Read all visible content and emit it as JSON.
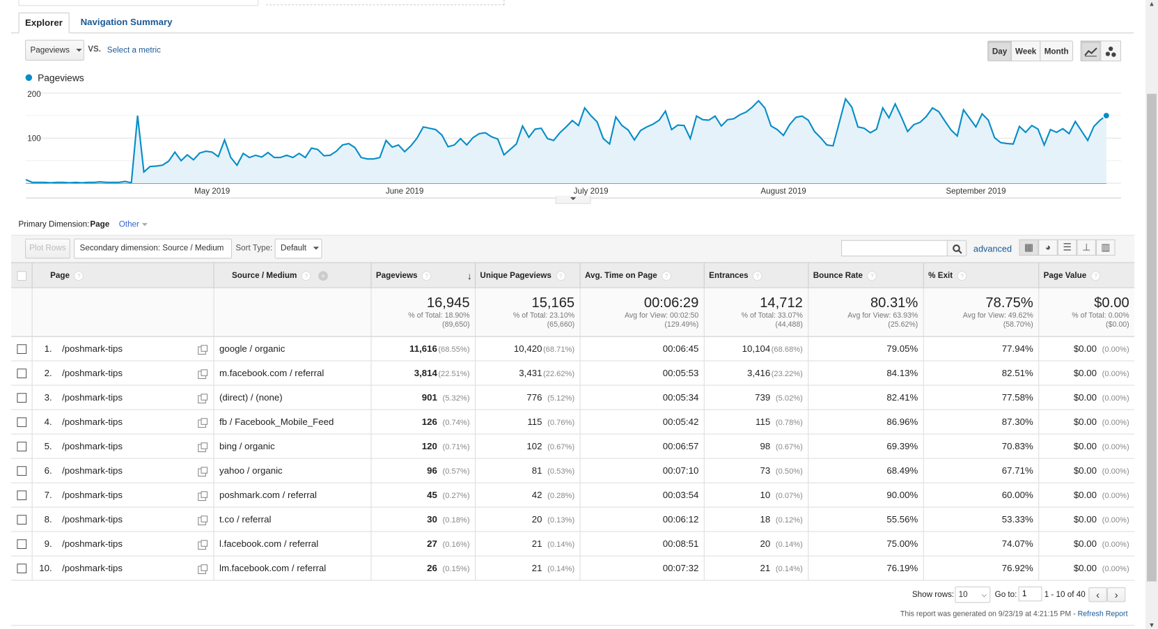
{
  "tabs": {
    "explorer": "Explorer",
    "navigation_summary": "Navigation Summary"
  },
  "metric_selector": {
    "selected": "Pageviews",
    "vs_label": "VS.",
    "select_metric_link": "Select a metric"
  },
  "granularity": {
    "options": [
      "Day",
      "Week",
      "Month"
    ],
    "selected": "Day"
  },
  "chart_type_buttons": [
    "line-chart-icon",
    "motion-chart-icon"
  ],
  "chart_data": {
    "type": "area",
    "series": [
      {
        "name": "Pageviews",
        "color": "#058dc7",
        "frequency": "day",
        "date_range": [
          "2019-04-01",
          "2019-09-22"
        ],
        "values": [
          8,
          2,
          2,
          2,
          1,
          2,
          2,
          1,
          2,
          1,
          2,
          2,
          3,
          2,
          2,
          2,
          4,
          1,
          150,
          25,
          37,
          38,
          40,
          49,
          69,
          50,
          63,
          52,
          67,
          71,
          69,
          59,
          96,
          57,
          40,
          66,
          57,
          62,
          58,
          68,
          57,
          57,
          62,
          57,
          66,
          57,
          78,
          75,
          61,
          62,
          71,
          85,
          88,
          79,
          57,
          54,
          54,
          57,
          95,
          80,
          85,
          70,
          83,
          100,
          125,
          122,
          119,
          107,
          81,
          85,
          99,
          85,
          101,
          110,
          112,
          103,
          98,
          63,
          75,
          87,
          127,
          102,
          120,
          122,
          99,
          95,
          112,
          125,
          139,
          128,
          167,
          150,
          136,
          99,
          87,
          147,
          128,
          118,
          96,
          117,
          125,
          131,
          140,
          160,
          119,
          129,
          128,
          99,
          149,
          141,
          140,
          149,
          127,
          141,
          143,
          152,
          158,
          169,
          183,
          167,
          127,
          119,
          106,
          130,
          146,
          149,
          140,
          115,
          101,
          85,
          83,
          135,
          187,
          169,
          125,
          122,
          112,
          120,
          167,
          145,
          176,
          147,
          115,
          130,
          135,
          148,
          167,
          159,
          138,
          118,
          105,
          163,
          144,
          125,
          154,
          140,
          101,
          90,
          88,
          87,
          126,
          113,
          128,
          120,
          85,
          119,
          113,
          121,
          110,
          137,
          116,
          95,
          126,
          140,
          150
        ]
      }
    ],
    "legend": "Pageviews",
    "legend_placement": "top-left",
    "y_ticks": [
      "100",
      "200"
    ],
    "ylim": [
      0,
      200
    ],
    "x_ticks": [
      {
        "date": "2019-05-01",
        "label": "May 2019"
      },
      {
        "date": "2019-06-01",
        "label": "June 2019"
      },
      {
        "date": "2019-07-01",
        "label": "July 2019"
      },
      {
        "date": "2019-08-01",
        "label": "August 2019"
      },
      {
        "date": "2019-09-01",
        "label": "September 2019"
      }
    ],
    "grid": true
  },
  "dimension": {
    "label": "Primary Dimension:",
    "selected": "Page",
    "other": "Other"
  },
  "toolbar": {
    "plot_rows": "Plot Rows",
    "secondary_dimension": "Secondary dimension: Source / Medium",
    "sort_type_label": "Sort Type:",
    "sort_type": "Default",
    "search_placeholder": "",
    "advanced": "advanced"
  },
  "table": {
    "headers": {
      "page": "Page",
      "source_medium": "Source / Medium",
      "pageviews": "Pageviews",
      "unique_pageviews": "Unique Pageviews",
      "avg_time": "Avg. Time on Page",
      "entrances": "Entrances",
      "bounce_rate": "Bounce Rate",
      "exit": "% Exit",
      "page_value": "Page Value"
    },
    "totals": {
      "pageviews": {
        "value": "16,945",
        "line1": "% of Total: 18.90%",
        "line2": "(89,650)"
      },
      "unique_pageviews": {
        "value": "15,165",
        "line1": "% of Total: 23.10%",
        "line2": "(65,660)"
      },
      "avg_time": {
        "value": "00:06:29",
        "line1": "Avg for View: 00:02:50",
        "line2": "(129.49%)"
      },
      "entrances": {
        "value": "14,712",
        "line1": "% of Total: 33.07%",
        "line2": "(44,488)"
      },
      "bounce_rate": {
        "value": "80.31%",
        "line1": "Avg for View: 63.93%",
        "line2": "(25.62%)"
      },
      "exit": {
        "value": "78.75%",
        "line1": "Avg for View: 49.62%",
        "line2": "(58.70%)"
      },
      "page_value": {
        "value": "$0.00",
        "line1": "% of Total: 0.00%",
        "line2": "($0.00)"
      }
    },
    "rows": [
      {
        "num": "1.",
        "page": "/poshmark-tips",
        "source": "google / organic",
        "pv": "11,616",
        "pv_pct": "(68.55%)",
        "upv": "10,420",
        "upv_pct": "(68.71%)",
        "time": "00:06:45",
        "ent": "10,104",
        "ent_pct": "(68.68%)",
        "bounce": "79.05%",
        "exit": "77.94%",
        "value": "$0.00",
        "value_pct": "(0.00%)"
      },
      {
        "num": "2.",
        "page": "/poshmark-tips",
        "source": "m.facebook.com / referral",
        "pv": "3,814",
        "pv_pct": "(22.51%)",
        "upv": "3,431",
        "upv_pct": "(22.62%)",
        "time": "00:05:53",
        "ent": "3,416",
        "ent_pct": "(23.22%)",
        "bounce": "84.13%",
        "exit": "82.51%",
        "value": "$0.00",
        "value_pct": "(0.00%)"
      },
      {
        "num": "3.",
        "page": "/poshmark-tips",
        "source": "(direct) / (none)",
        "pv": "901",
        "pv_pct": "(5.32%)",
        "upv": "776",
        "upv_pct": "(5.12%)",
        "time": "00:05:34",
        "ent": "739",
        "ent_pct": "(5.02%)",
        "bounce": "82.41%",
        "exit": "77.58%",
        "value": "$0.00",
        "value_pct": "(0.00%)"
      },
      {
        "num": "4.",
        "page": "/poshmark-tips",
        "source": "fb / Facebook_Mobile_Feed",
        "pv": "126",
        "pv_pct": "(0.74%)",
        "upv": "115",
        "upv_pct": "(0.76%)",
        "time": "00:05:42",
        "ent": "115",
        "ent_pct": "(0.78%)",
        "bounce": "86.96%",
        "exit": "87.30%",
        "value": "$0.00",
        "value_pct": "(0.00%)"
      },
      {
        "num": "5.",
        "page": "/poshmark-tips",
        "source": "bing / organic",
        "pv": "120",
        "pv_pct": "(0.71%)",
        "upv": "102",
        "upv_pct": "(0.67%)",
        "time": "00:06:57",
        "ent": "98",
        "ent_pct": "(0.67%)",
        "bounce": "69.39%",
        "exit": "70.83%",
        "value": "$0.00",
        "value_pct": "(0.00%)"
      },
      {
        "num": "6.",
        "page": "/poshmark-tips",
        "source": "yahoo / organic",
        "pv": "96",
        "pv_pct": "(0.57%)",
        "upv": "81",
        "upv_pct": "(0.53%)",
        "time": "00:07:10",
        "ent": "73",
        "ent_pct": "(0.50%)",
        "bounce": "68.49%",
        "exit": "67.71%",
        "value": "$0.00",
        "value_pct": "(0.00%)"
      },
      {
        "num": "7.",
        "page": "/poshmark-tips",
        "source": "poshmark.com / referral",
        "pv": "45",
        "pv_pct": "(0.27%)",
        "upv": "42",
        "upv_pct": "(0.28%)",
        "time": "00:03:54",
        "ent": "10",
        "ent_pct": "(0.07%)",
        "bounce": "90.00%",
        "exit": "60.00%",
        "value": "$0.00",
        "value_pct": "(0.00%)"
      },
      {
        "num": "8.",
        "page": "/poshmark-tips",
        "source": "t.co / referral",
        "pv": "30",
        "pv_pct": "(0.18%)",
        "upv": "20",
        "upv_pct": "(0.13%)",
        "time": "00:06:12",
        "ent": "18",
        "ent_pct": "(0.12%)",
        "bounce": "55.56%",
        "exit": "53.33%",
        "value": "$0.00",
        "value_pct": "(0.00%)"
      },
      {
        "num": "9.",
        "page": "/poshmark-tips",
        "source": "l.facebook.com / referral",
        "pv": "27",
        "pv_pct": "(0.16%)",
        "upv": "21",
        "upv_pct": "(0.14%)",
        "time": "00:08:51",
        "ent": "20",
        "ent_pct": "(0.14%)",
        "bounce": "75.00%",
        "exit": "74.07%",
        "value": "$0.00",
        "value_pct": "(0.00%)"
      },
      {
        "num": "10.",
        "page": "/poshmark-tips",
        "source": "lm.facebook.com / referral",
        "pv": "26",
        "pv_pct": "(0.15%)",
        "upv": "21",
        "upv_pct": "(0.14%)",
        "time": "00:07:32",
        "ent": "21",
        "ent_pct": "(0.14%)",
        "bounce": "76.19%",
        "exit": "76.92%",
        "value": "$0.00",
        "value_pct": "(0.00%)"
      }
    ]
  },
  "pagination": {
    "show_rows_label": "Show rows:",
    "show_rows": "10",
    "goto_label": "Go to:",
    "goto": "1",
    "range": "1 - 10 of 40"
  },
  "footer": {
    "generated": "This report was generated on 9/23/19 at 4:21:15 PM - ",
    "refresh": "Refresh Report"
  }
}
